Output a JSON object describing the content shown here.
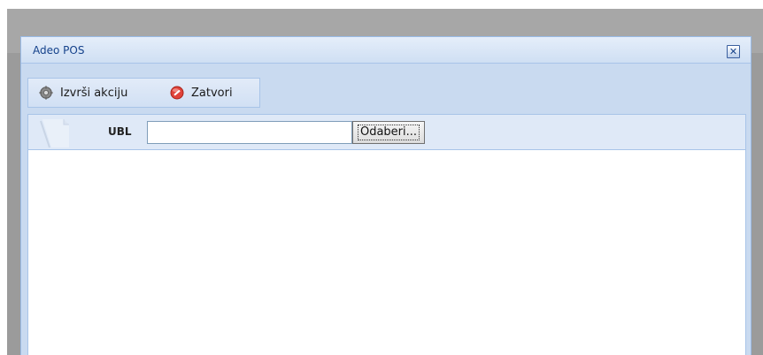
{
  "dialog": {
    "title": "Adeo POS",
    "close_icon": "close-icon"
  },
  "toolbar": {
    "action_label": "Izvrši akciju",
    "action_icon": "gear-icon",
    "close_label": "Zatvori",
    "close_icon": "stop-icon"
  },
  "form": {
    "field_label": "UBL",
    "field_value": "",
    "browse_label": "Odaberi..."
  },
  "colors": {
    "title_text": "#15428b",
    "panel_bg": "#c9daf0",
    "form_row_bg": "#dfe9f7",
    "border": "#a8c4e8"
  }
}
